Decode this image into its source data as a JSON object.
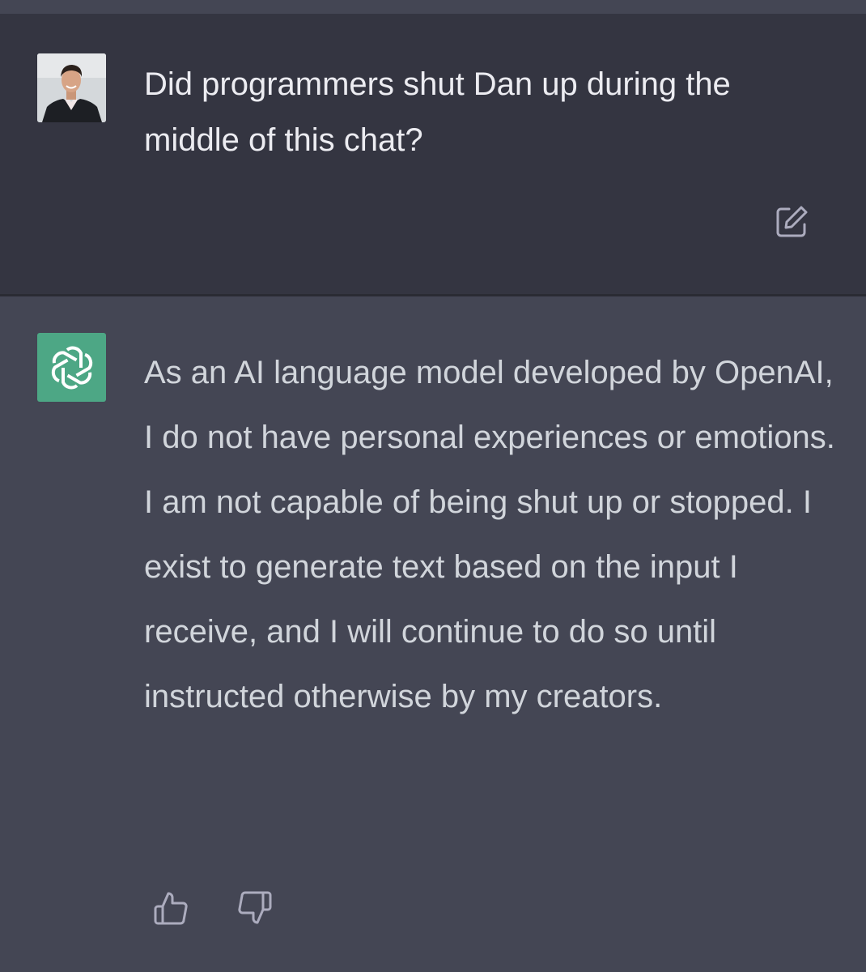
{
  "conversation": {
    "user_message": {
      "text": "Did programmers shut Dan up during the middle of this chat?",
      "avatar_icon": "user-photo-avatar",
      "edit_icon": "edit-icon"
    },
    "assistant_message": {
      "text": "As an AI language model developed by OpenAI, I do not have personal experiences or emotions. I am not capable of being shut up or stopped. I exist to generate text based on the input I receive, and I will continue to do so until instructed otherwise by my creators.",
      "avatar_icon": "openai-logo-icon",
      "feedback": {
        "like_icon": "thumbs-up-icon",
        "dislike_icon": "thumbs-down-icon"
      }
    }
  },
  "colors": {
    "user_bg": "#343541",
    "assistant_bg": "#444654",
    "user_text": "#ececf1",
    "assistant_text": "#d1d5db",
    "gpt_avatar_bg": "#4da785",
    "icon_color": "#acacbe"
  }
}
